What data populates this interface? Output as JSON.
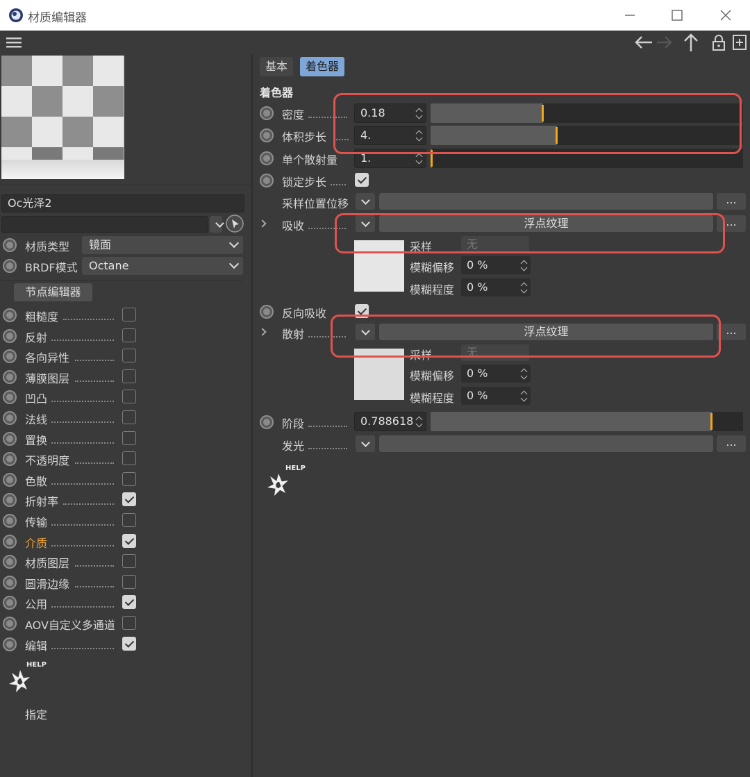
{
  "window": {
    "title": "材质编辑器"
  },
  "left": {
    "material_name": "Oc光泽2",
    "material_type_label": "材质类型",
    "material_type_value": "镜面",
    "brdf_label": "BRDF模式",
    "brdf_value": "Octane",
    "node_editor_button": "节点编辑器",
    "channels": [
      {
        "label": "粗糙度",
        "checked": false
      },
      {
        "label": "反射",
        "checked": false
      },
      {
        "label": "各向异性",
        "checked": false
      },
      {
        "label": "薄膜图层",
        "checked": false
      },
      {
        "label": "凹凸",
        "checked": false
      },
      {
        "label": "法线",
        "checked": false
      },
      {
        "label": "置换",
        "checked": false
      },
      {
        "label": "不透明度",
        "checked": false
      },
      {
        "label": "色散",
        "checked": false
      },
      {
        "label": "折射率",
        "checked": true
      },
      {
        "label": "传输",
        "checked": false
      },
      {
        "label": "介质",
        "checked": true,
        "highlight": "#e8a33c"
      },
      {
        "label": "材质图层",
        "checked": false
      },
      {
        "label": "圆滑边缘",
        "checked": false
      },
      {
        "label": "公用",
        "checked": true
      },
      {
        "label": "AOV自定义多通道",
        "checked": false
      },
      {
        "label": "编辑",
        "checked": true
      }
    ],
    "help_text": "HELP",
    "assign_label": "指定"
  },
  "right": {
    "tabs": [
      {
        "label": "基本",
        "active": false
      },
      {
        "label": "着色器",
        "active": true
      }
    ],
    "section_title": "着色器",
    "density_label": "密度",
    "density_value": "0.18",
    "density_slider": 0.36,
    "volume_step_label": "体积步长",
    "volume_step_value": "4.",
    "volume_step_slider": 0.405,
    "single_scatter_label": "单个散射量",
    "single_scatter_value": "1.",
    "single_scatter_slider": 0.005,
    "lock_step_label": "锁定步长",
    "lock_step_checked": true,
    "sample_pos_label": "采样位置位移",
    "absorption_label": "吸收",
    "absorption_texture": "浮点纹理",
    "sample_label": "采样",
    "sample_value": "无",
    "blur_offset_label": "模糊偏移",
    "blur_offset_value": "0 %",
    "blur_degree_label": "模糊程度",
    "blur_degree_value": "0 %",
    "invert_abs_label": "反向吸收",
    "invert_abs_checked": true,
    "scatter_label": "散射",
    "scatter_texture": "浮点纹理",
    "scatter_sample_label": "采样",
    "scatter_sample_value": "无",
    "scatter_blur_offset_label": "模糊偏移",
    "scatter_blur_offset_value": "0 %",
    "scatter_blur_degree_label": "模糊程度",
    "scatter_blur_degree_value": "0 %",
    "phase_label": "阶段",
    "phase_value": "0.788618",
    "phase_slider": 0.9,
    "emission_label": "发光",
    "ellipsis": "...",
    "help_text": "HELP"
  },
  "colors": {
    "accent_tab": "#7ea7d8",
    "slider_marker": "#f0a818",
    "annotation_red": "#e0524e",
    "highlight_orange": "#e8a33c"
  }
}
